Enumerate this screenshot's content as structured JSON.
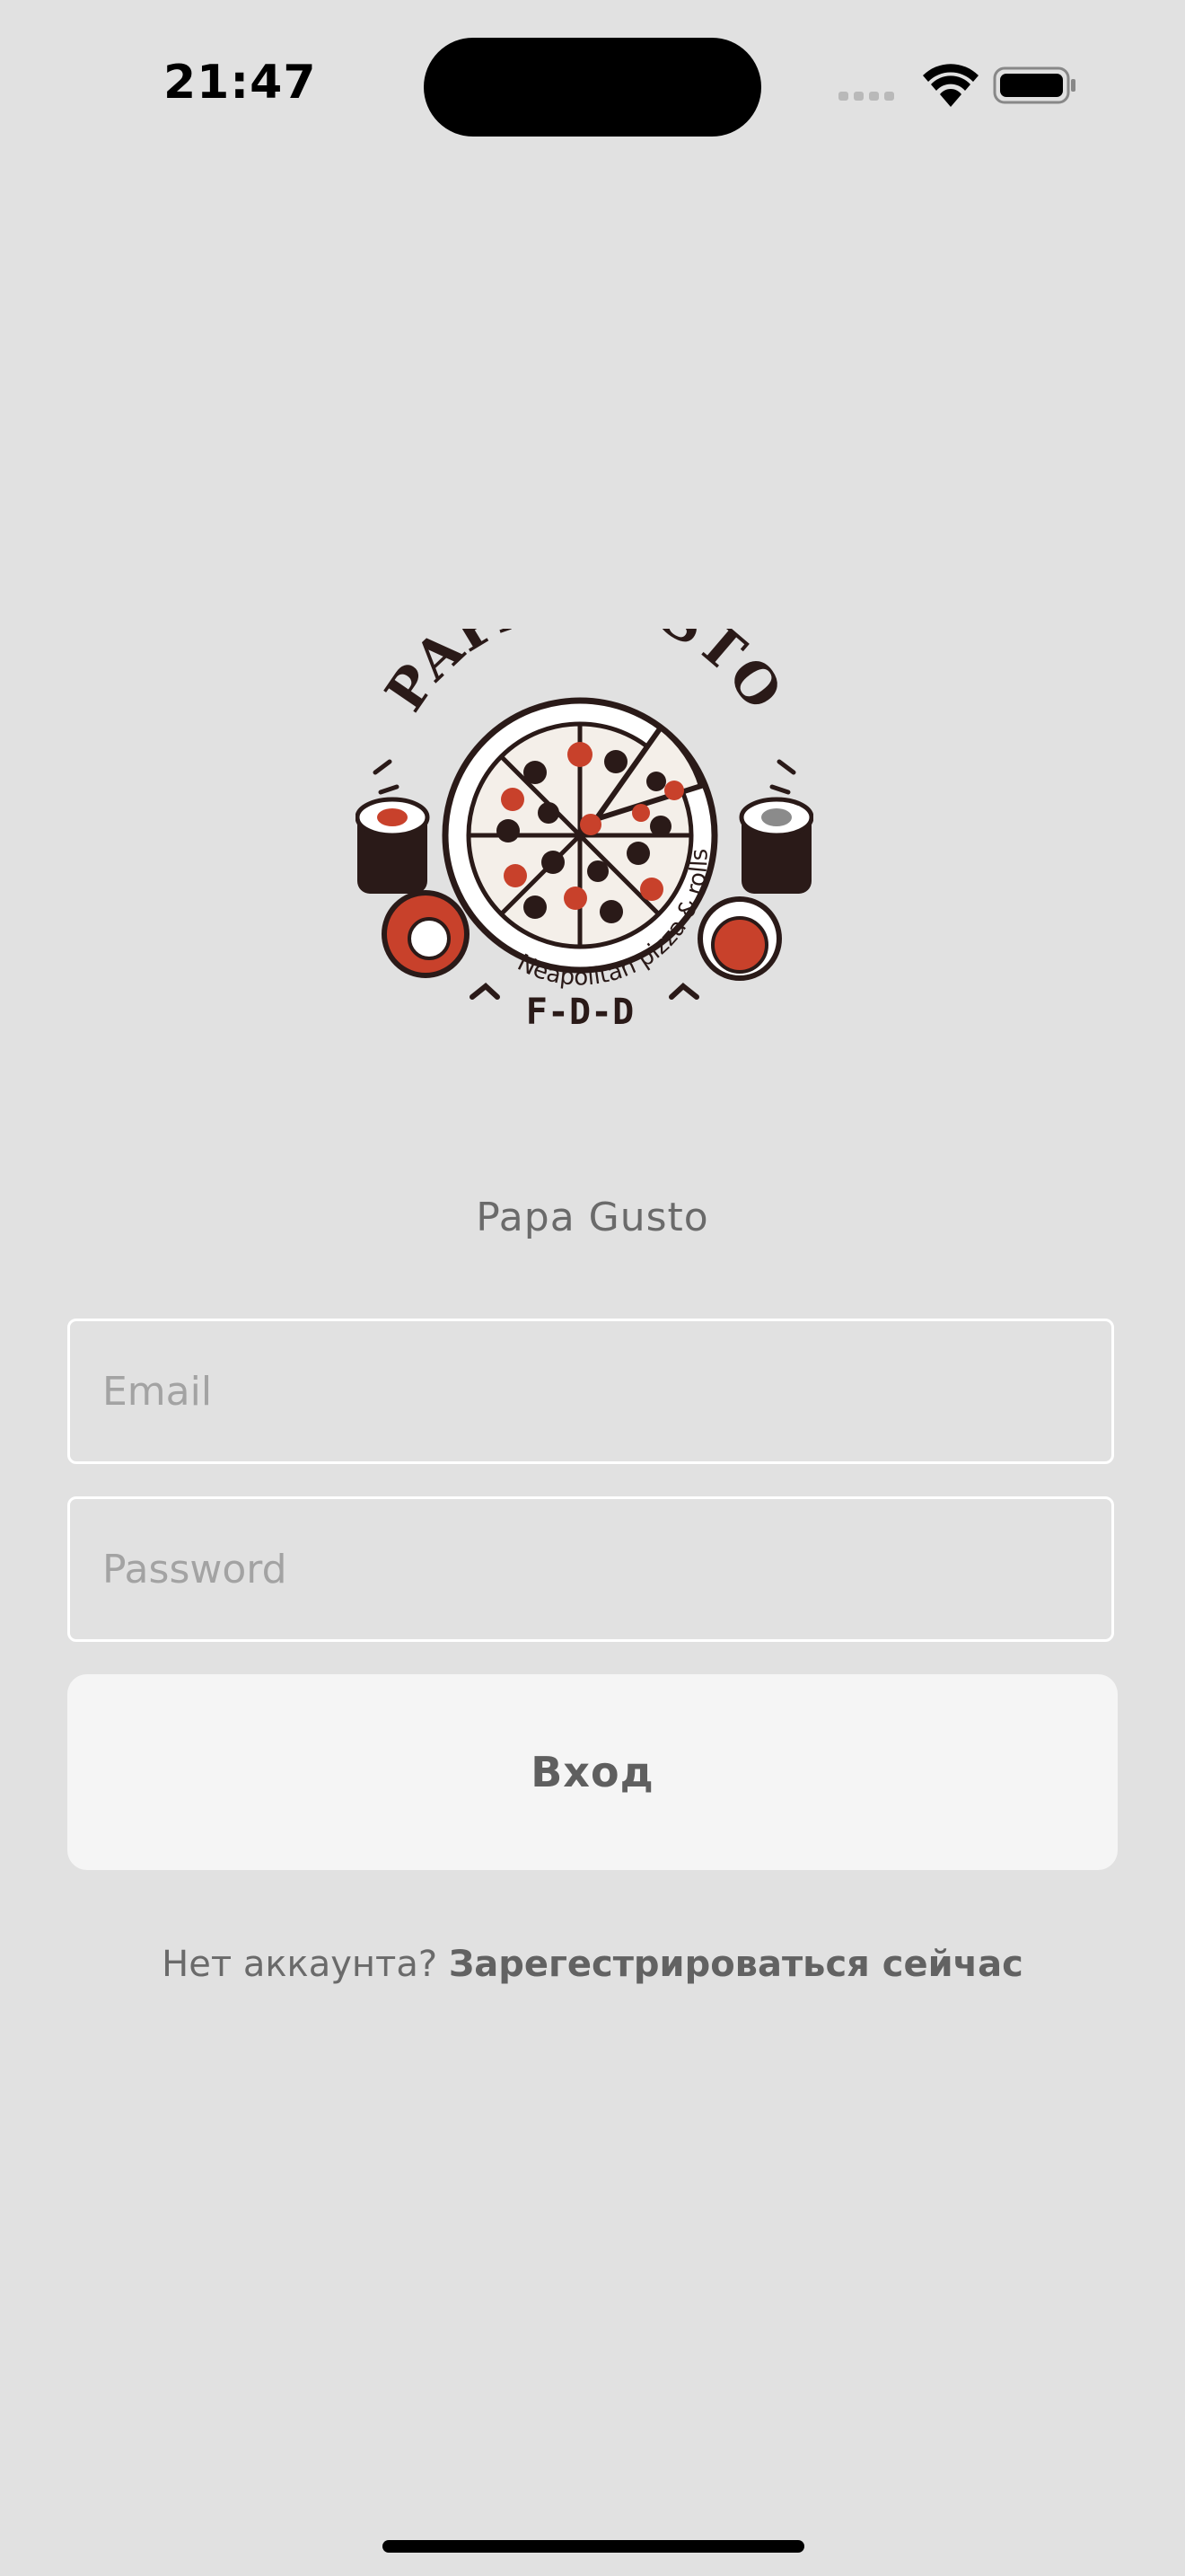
{
  "status_bar": {
    "time": "21:47",
    "signal_icon": "cellular-signal-icon",
    "wifi_icon": "wifi-icon",
    "battery_icon": "battery-icon"
  },
  "logo": {
    "brand_text": "PAPA GUSTO",
    "tagline": "Neapolitan pizza & rolls",
    "sub_mark": "F-D-D",
    "icon": "pizza-sushi-logo"
  },
  "app_name": "Papa Gusto",
  "form": {
    "email_placeholder": "Email",
    "email_value": "",
    "password_placeholder": "Password",
    "password_value": "",
    "login_label": "Вход"
  },
  "register": {
    "prompt": "Нет аккаунта?",
    "link_label": "Зарегестрироваться сейчас"
  },
  "colors": {
    "background": "#e1e1e1",
    "button_bg": "#f5f5f5",
    "field_border": "#ffffff",
    "text_muted": "#6a6a6a",
    "logo_red": "#c8412b",
    "logo_dark": "#2a1a18"
  }
}
